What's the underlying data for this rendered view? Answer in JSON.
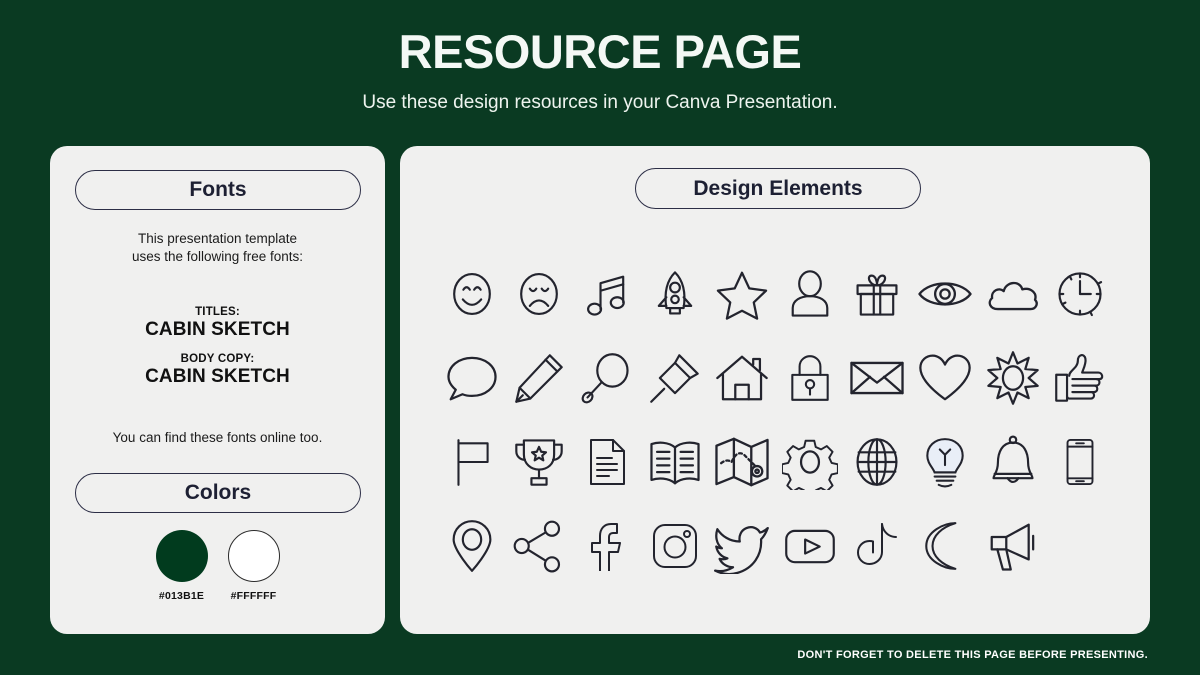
{
  "header": {
    "title": "RESOURCE PAGE",
    "subtitle": "Use these design resources in your Canva Presentation."
  },
  "fonts_panel": {
    "pill_label": "Fonts",
    "intro_line1": "This presentation template",
    "intro_line2": "uses the following free fonts:",
    "titles_label": "TITLES:",
    "titles_font": "CABIN SKETCH",
    "body_label": "BODY COPY:",
    "body_font": "CABIN SKETCH",
    "online_note": "You can find these fonts online too."
  },
  "colors_panel": {
    "pill_label": "Colors",
    "swatches": [
      {
        "name": "primary-green-swatch",
        "hex": "#013B1E"
      },
      {
        "name": "white-swatch",
        "hex": "#FFFFFF"
      }
    ]
  },
  "design_panel": {
    "pill_label": "Design Elements",
    "icons": [
      "smiley-face-icon",
      "sad-face-icon",
      "music-note-icon",
      "rocket-icon",
      "star-icon",
      "person-icon",
      "gift-icon",
      "eye-icon",
      "cloud-icon",
      "clock-icon",
      "speech-bubble-icon",
      "pencil-icon",
      "magnifying-glass-icon",
      "pushpin-icon",
      "house-icon",
      "lock-icon",
      "envelope-icon",
      "heart-icon",
      "sun-icon",
      "thumbs-up-icon",
      "flag-icon",
      "trophy-icon",
      "document-icon",
      "open-book-icon",
      "map-icon",
      "gear-icon",
      "globe-icon",
      "lightbulb-icon",
      "bell-icon",
      "smartphone-icon",
      "map-pin-icon",
      "share-icon",
      "facebook-icon",
      "instagram-icon",
      "twitter-icon",
      "youtube-icon",
      "tiktok-icon",
      "moon-icon",
      "megaphone-icon"
    ]
  },
  "footer": {
    "note": "DON'T FORGET TO DELETE THIS PAGE BEFORE PRESENTING."
  },
  "theme": {
    "background": "#0A3A22",
    "panel_background": "#F0F0EF",
    "ink": "#23242E",
    "title_color": "#F4F8F5"
  }
}
